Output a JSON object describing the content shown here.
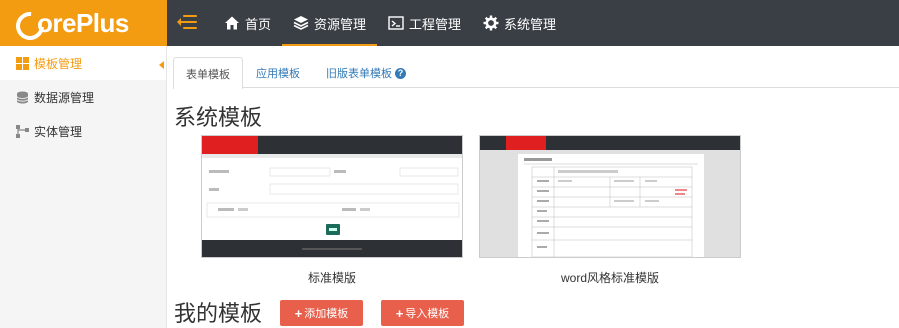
{
  "logo": {
    "text": "orePlus"
  },
  "nav": {
    "items": [
      {
        "label": "首页",
        "icon": "home-icon"
      },
      {
        "label": "资源管理",
        "icon": "layers-icon"
      },
      {
        "label": "工程管理",
        "icon": "terminal-icon"
      },
      {
        "label": "系统管理",
        "icon": "gear-icon"
      }
    ],
    "active": "资源管理"
  },
  "sidebar": {
    "items": [
      {
        "label": "模板管理",
        "icon": "grid-icon"
      },
      {
        "label": "数据源管理",
        "icon": "database-icon"
      },
      {
        "label": "实体管理",
        "icon": "sitemap-icon"
      }
    ],
    "active": "模板管理"
  },
  "tabs": [
    {
      "label": "表单模板"
    },
    {
      "label": "应用模板"
    },
    {
      "label": "旧版表单模板",
      "help_icon": "?"
    }
  ],
  "system_section": {
    "title": "系统模板"
  },
  "templates": [
    {
      "label": "标准模版"
    },
    {
      "label": "word风格标准模版"
    }
  ],
  "my_section": {
    "title": "我的模板"
  },
  "buttons": {
    "add": "添加模板",
    "import": "导入模板",
    "plus": "+"
  },
  "colors": {
    "accent": "#f39c12",
    "topbar": "#3a3f45",
    "button": "#e8604c",
    "link": "#337ab7"
  }
}
